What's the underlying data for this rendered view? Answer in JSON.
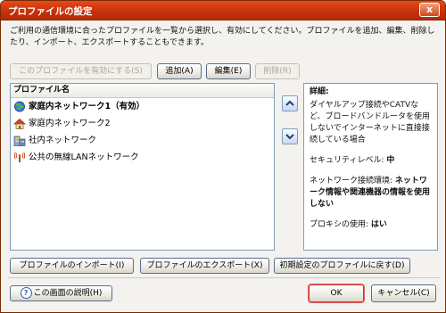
{
  "window": {
    "title": "プロファイルの設定",
    "close_label": "x"
  },
  "description": "ご利用の通信環境に合ったプロファイルを一覧から選択し、有効にしてください。プロファイルを追加、編集、削除したり、インポート、エクスポートすることもできます。",
  "toolbar": {
    "enable_label": "このプロファイルを有効にする(S)",
    "add_label": "追加(A)",
    "edit_label": "編集(E)",
    "delete_label": "削除(R)"
  },
  "list": {
    "header": "プロファイル名",
    "items": [
      {
        "label": "家庭内ネットワーク1（有効）",
        "icon": "globe-network-icon"
      },
      {
        "label": "家庭内ネットワーク2",
        "icon": "home-icon"
      },
      {
        "label": "社内ネットワーク",
        "icon": "office-building-icon"
      },
      {
        "label": "公共の無線LANネットワーク",
        "icon": "wireless-icon"
      }
    ]
  },
  "detail": {
    "heading": "詳細:",
    "description": "ダイヤルアップ接続やCATVなど、ブロードバンドルータを使用しないでインターネットに直接接続している場合",
    "security_label": "セキュリティレベル:",
    "security_value": "中",
    "network_label": "ネットワーク接続環境:",
    "network_value": "ネットワーク情報や関連機器の情報を使用しない",
    "proxy_label": "プロキシの使用:",
    "proxy_value": "はい"
  },
  "bottom": {
    "import_label": "プロファイルのインポート(I)",
    "export_label": "プロファイルのエクスポート(X)",
    "reset_label": "初期設定のプロファイルに戻す(D)",
    "help_label": "この画面の説明(H)",
    "ok_label": "OK",
    "cancel_label": "キャンセル(C)"
  },
  "colors": {
    "titlebar": "#d03a10",
    "accent_border": "#7f9db9",
    "ok_highlight": "#cc3333"
  }
}
